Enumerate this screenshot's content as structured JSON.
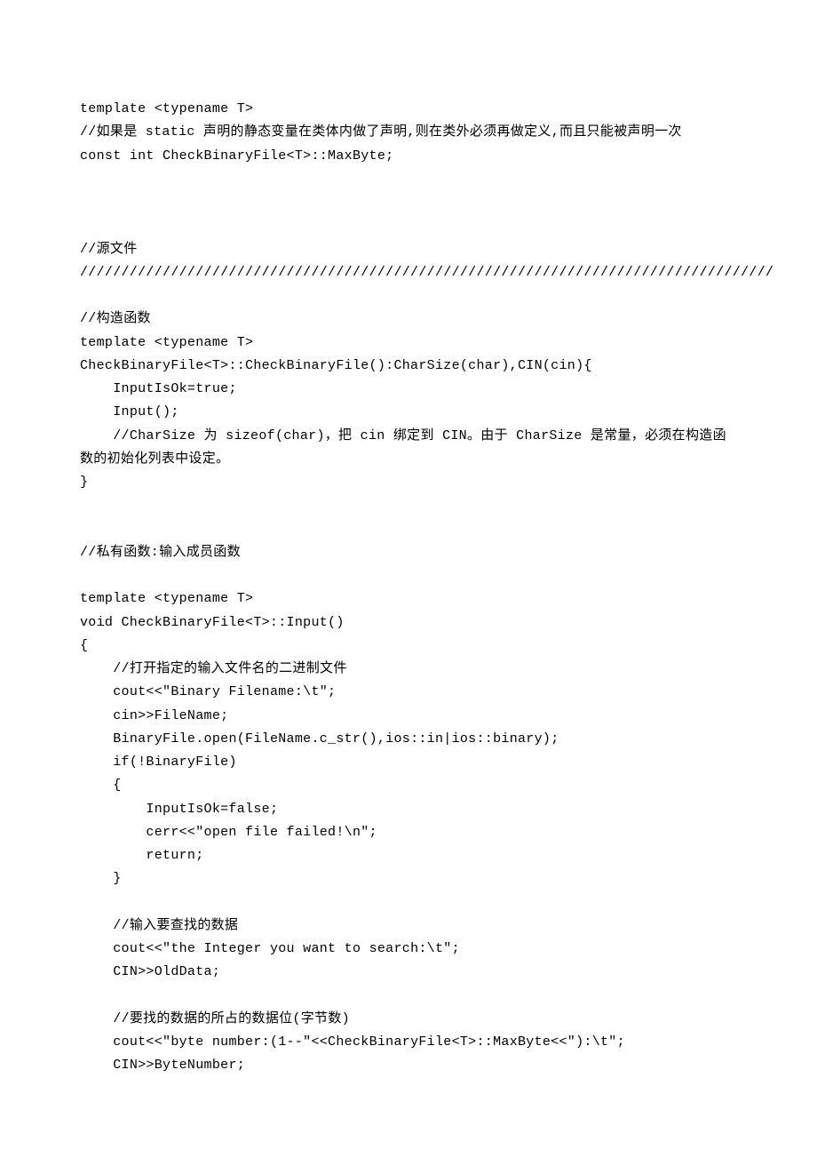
{
  "lines": [
    "template <typename T>",
    "//如果是 static 声明的静态变量在类体内做了声明,则在类外必须再做定义,而且只能被声明一次",
    "const int CheckBinaryFile<T>::MaxByte;",
    "",
    "",
    "",
    "//源文件",
    "////////////////////////////////////////////////////////////////////////////////////",
    "",
    "//构造函数",
    "template <typename T>",
    "CheckBinaryFile<T>::CheckBinaryFile():CharSize(char),CIN(cin){",
    "    InputIsOk=true;",
    "    Input();",
    "    //CharSize 为 sizeof(char)，把 cin 绑定到 CIN。由于 CharSize 是常量，必须在构造函数的初始化列表中设定。",
    "}",
    "",
    "",
    "//私有函数:输入成员函数",
    "",
    "template <typename T>",
    "void CheckBinaryFile<T>::Input()",
    "{",
    "    //打开指定的输入文件名的二进制文件",
    "    cout<<\"Binary Filename:\\t\";",
    "    cin>>FileName;",
    "    BinaryFile.open(FileName.c_str(),ios::in|ios::binary);",
    "    if(!BinaryFile)",
    "    {",
    "        InputIsOk=false;",
    "        cerr<<\"open file failed!\\n\";",
    "        return;",
    "    }",
    "",
    "    //输入要查找的数据",
    "    cout<<\"the Integer you want to search:\\t\";",
    "    CIN>>OldData;",
    "",
    "    //要找的数据的所占的数据位(字节数)",
    "    cout<<\"byte number:(1--\"<<CheckBinaryFile<T>::MaxByte<<\"):\\t\";",
    "    CIN>>ByteNumber;"
  ]
}
